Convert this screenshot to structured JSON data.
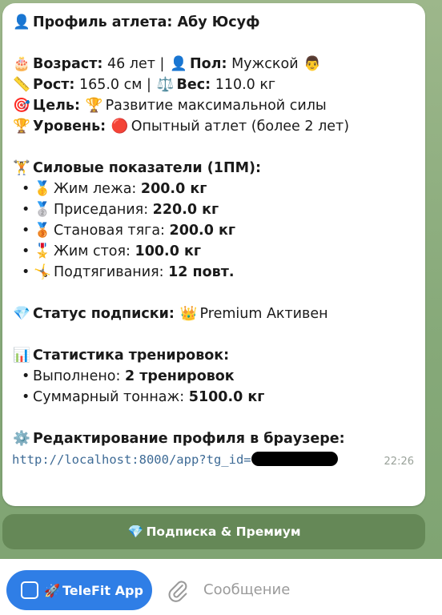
{
  "profile": {
    "title_icon": "👤",
    "title": "Профиль атлета: Абу Юсуф",
    "age_icon": "🎂",
    "age_label": "Возраст:",
    "age_value": "46 лет",
    "sep": "|",
    "gender_icon": "👤",
    "gender_label": "Пол:",
    "gender_value": "Мужской",
    "gender_emoji": "👨",
    "height_icon": "📏",
    "height_label": "Рост:",
    "height_value": "165.0 см",
    "weight_icon": "⚖️",
    "weight_label": "Вес:",
    "weight_value": "110.0 кг",
    "goal_icon": "🎯",
    "goal_label": "Цель:",
    "goal_emoji": "🏆",
    "goal_value": "Развитие максимальной силы",
    "level_icon": "🏆",
    "level_label": "Уровень:",
    "level_emoji": "🔴",
    "level_value": "Опытный атлет (более 2 лет)"
  },
  "strength": {
    "icon": "🏋️",
    "header": "Силовые показатели (1ПМ):",
    "bullet": "•",
    "items": [
      {
        "icon": "🥇",
        "label": "Жим лежа:",
        "value": "200.0 кг"
      },
      {
        "icon": "🥈",
        "label": "Приседания:",
        "value": "220.0 кг"
      },
      {
        "icon": "🥉",
        "label": "Становая тяга:",
        "value": "200.0 кг"
      },
      {
        "icon": "🎖️",
        "label": "Жим стоя:",
        "value": "100.0 кг"
      },
      {
        "icon": "🤸",
        "label": "Подтягивания:",
        "value": "12 повт."
      }
    ]
  },
  "subscription": {
    "icon": "💎",
    "label": "Статус подписки:",
    "crown": "👑",
    "value": "Premium Активен"
  },
  "stats": {
    "icon": "📊",
    "header": "Статистика тренировок:",
    "bullet": "•",
    "done_label": "Выполнено:",
    "done_value": "2 тренировок",
    "tonnage_label": "Суммарный тоннаж:",
    "tonnage_value": "5100.0 кг"
  },
  "edit": {
    "icon": "⚙️",
    "header": "Редактирование профиля в браузере:",
    "link": "http://localhost:8000/app?tg_id=",
    "time": "22:26"
  },
  "buttons": {
    "inline_icon": "💎",
    "inline_label": "Подписка & Премиум",
    "app_emoji": "🚀",
    "app_label": "TeleFit App"
  },
  "input": {
    "placeholder": "Сообщение"
  },
  "colors": {
    "link": "#3e6b96",
    "app_button": "#2f7ee6",
    "inline_button": "#5e8050"
  }
}
